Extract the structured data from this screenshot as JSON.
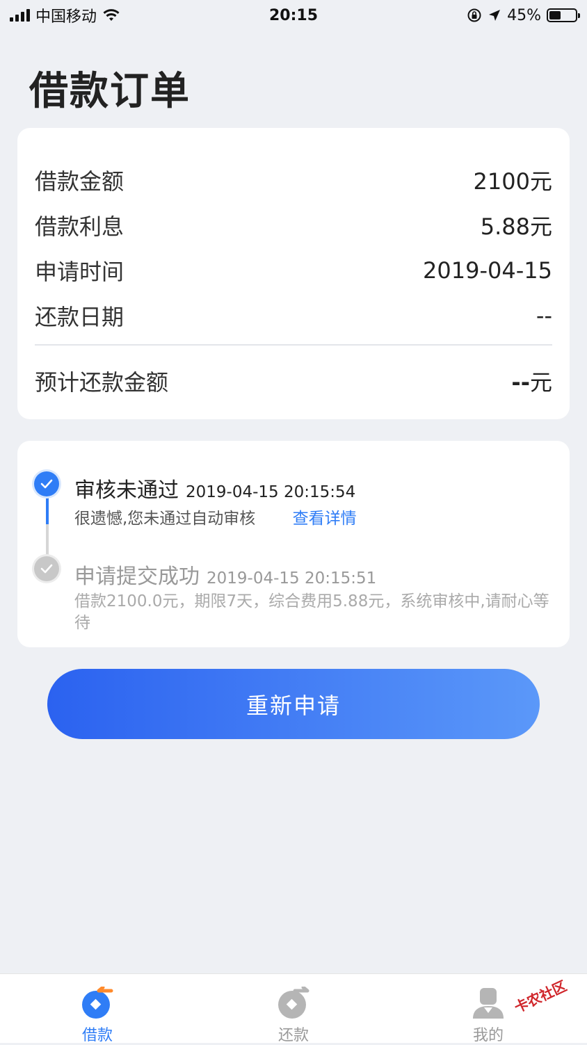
{
  "status_bar": {
    "carrier": "中国移动",
    "time": "20:15",
    "battery": "45%",
    "battery_level": 0.45
  },
  "page": {
    "title": "借款订单"
  },
  "order": {
    "rows": [
      {
        "label": "借款金额",
        "value": "2100元"
      },
      {
        "label": "借款利息",
        "value": "5.88元"
      },
      {
        "label": "申请时间",
        "value": "2019-04-15"
      },
      {
        "label": "还款日期",
        "value": "--"
      }
    ],
    "expected": {
      "label": "预计还款金额",
      "value_dash": "--",
      "value_unit": "元"
    }
  },
  "timeline": {
    "steps": [
      {
        "title": "审核未通过",
        "time": "2019-04-15 20:15:54",
        "desc": "很遗憾,您未通过自动审核",
        "link": "查看详情",
        "status": "current",
        "color": "#2f7df6"
      },
      {
        "title": "申请提交成功",
        "time": "2019-04-15 20:15:51",
        "desc": "借款2100.0元，期限7天，综合费用5.88元，系统审核中,请耐心等待",
        "status": "done",
        "color": "#c8c8c8"
      }
    ]
  },
  "actions": {
    "reapply_label": "重新申请"
  },
  "tabbar": {
    "tabs": [
      {
        "label": "借款",
        "icon": "borrow-icon",
        "active": true
      },
      {
        "label": "还款",
        "icon": "repay-icon",
        "active": false
      },
      {
        "label": "我的",
        "icon": "profile-icon",
        "active": false
      }
    ]
  },
  "watermark": {
    "text": "卡农社区"
  },
  "colors": {
    "accent": "#2f7df6",
    "background": "#eef0f4",
    "inactive": "#999999"
  }
}
